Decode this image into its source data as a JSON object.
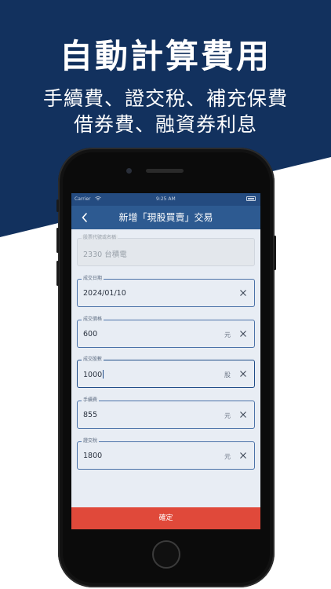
{
  "promo": {
    "headline": "自動計算費用",
    "line1": "手續費、證交稅、補充保費",
    "line2": "借券費、融資券利息",
    "colors": {
      "navy": "#12315e",
      "white": "#ffffff"
    }
  },
  "status_bar": {
    "carrier": "Carrier",
    "time": "9:25 AM"
  },
  "nav": {
    "back_icon": "chevron-left-icon",
    "title": "新增「現股買賣」交易"
  },
  "form": {
    "fields": [
      {
        "label": "股票代號或名稱",
        "value": "2330 台積電",
        "unit": "",
        "state": "disabled"
      },
      {
        "label": "成交日期",
        "value": "2024/01/10",
        "unit": "",
        "state": "normal"
      },
      {
        "label": "成交價格",
        "value": "600",
        "unit": "元",
        "state": "normal"
      },
      {
        "label": "成交股數",
        "value": "1000",
        "unit": "股",
        "state": "focused"
      },
      {
        "label": "手續費",
        "value": "855",
        "unit": "元",
        "state": "normal"
      },
      {
        "label": "證交稅",
        "value": "1800",
        "unit": "元",
        "state": "normal"
      }
    ]
  },
  "actions": {
    "confirm_label": "確定",
    "confirm_color": "#e0493a"
  }
}
